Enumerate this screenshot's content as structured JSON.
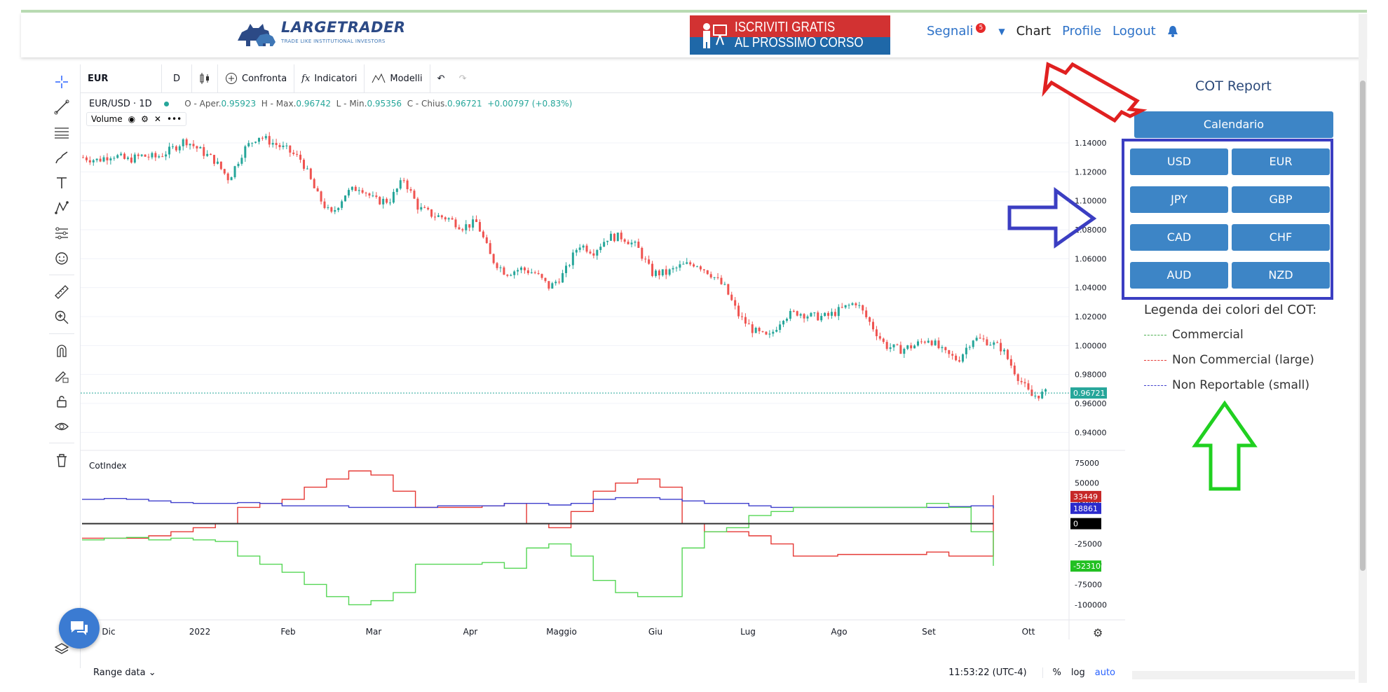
{
  "header": {
    "logo_text": "LARGETRADER",
    "logo_sub": "TRADE LIKE INSTITUTIONAL INVESTORS",
    "banner_line1": "ISCRIVITI GRATIS",
    "banner_line2": "AL PROSSIMO CORSO",
    "nav": {
      "segnali": "Segnali",
      "segnali_badge": "5",
      "chart": "Chart",
      "profile": "Profile",
      "logout": "Logout"
    }
  },
  "toolbar": {
    "symbol": "EUR",
    "interval": "D",
    "compare": "Confronta",
    "indicators": "Indicatori",
    "templates": "Modelli"
  },
  "legend": {
    "pair": "EUR/USD · 1D",
    "open_label": "O - Aper.",
    "open": "0.95923",
    "high_label": "H - Max.",
    "high": "0.96742",
    "low_label": "L - Min.",
    "low": "0.95356",
    "close_label": "C - Chius.",
    "close": "0.96721",
    "change": "+0.00797 (+0.83%)",
    "volume": "Volume",
    "cot_indicator": "CotIndex"
  },
  "chart_data": [
    {
      "type": "candlestick",
      "title": "EUR/USD · 1D",
      "ylim": [
        0.93,
        1.155
      ],
      "yticks": [
        "1.14000",
        "1.12000",
        "1.10000",
        "1.08000",
        "1.06000",
        "1.04000",
        "1.02000",
        "1.00000",
        "0.98000",
        "0.96000",
        "0.94000"
      ],
      "last_price": "0.96721",
      "x_ticks": [
        "Dic",
        "2022",
        "Feb",
        "Mar",
        "Apr",
        "Maggio",
        "Giu",
        "Lug",
        "Ago",
        "Set",
        "Ott"
      ],
      "close_path": [
        1.13,
        1.128,
        1.132,
        1.128,
        1.131,
        1.13,
        1.135,
        1.142,
        1.135,
        1.128,
        1.115,
        1.135,
        1.145,
        1.14,
        1.135,
        1.128,
        1.105,
        1.09,
        1.105,
        1.11,
        1.1,
        1.1,
        1.115,
        1.095,
        1.09,
        1.088,
        1.082,
        1.085,
        1.06,
        1.05,
        1.053,
        1.05,
        1.04,
        1.05,
        1.07,
        1.065,
        1.075,
        1.075,
        1.068,
        1.05,
        1.05,
        1.055,
        1.057,
        1.05,
        1.04,
        1.02,
        1.01,
        1.005,
        1.02,
        1.023,
        1.02,
        1.02,
        1.025,
        1.03,
        1.015,
        1.0,
        0.997,
        1.0,
        1.005,
        0.995,
        0.99,
        1.005,
        1.003,
        0.998,
        0.98,
        0.965,
        0.967
      ]
    },
    {
      "type": "line",
      "title": "CotIndex",
      "ylim": [
        -110000,
        80000
      ],
      "yticks": [
        "75000",
        "50000",
        "25000",
        "0",
        "-25000",
        "-50000",
        "-75000",
        "-100000"
      ],
      "series": [
        {
          "color": "#e53935",
          "last": "33449",
          "values": [
            -18000,
            -18000,
            -18000,
            -15000,
            -10000,
            -5000,
            0,
            20000,
            25000,
            30000,
            45000,
            55000,
            65000,
            60000,
            40000,
            20000,
            20000,
            20000,
            22000,
            25000,
            0,
            -5000,
            15000,
            40000,
            50000,
            55000,
            45000,
            0,
            -10000,
            -10000,
            -15000,
            -25000,
            -40000,
            -40000,
            -38000,
            -38000,
            -38000,
            -38000,
            -35000,
            -40000,
            -40000,
            35000
          ]
        },
        {
          "color": "#3f3fcc",
          "last": "18861",
          "values": [
            30000,
            31000,
            30000,
            28000,
            26000,
            25000,
            25000,
            26000,
            25000,
            22000,
            22000,
            22000,
            20000,
            20000,
            20000,
            20000,
            22000,
            22000,
            22000,
            25000,
            25000,
            23000,
            25000,
            30000,
            32000,
            32000,
            30000,
            28000,
            25000,
            25000,
            22000,
            20000,
            20000,
            20000,
            20000,
            20000,
            20000,
            20000,
            20000,
            21000,
            22000,
            19000
          ]
        },
        {
          "color": "#55d655",
          "last": "-52310",
          "values": [
            -20000,
            -18000,
            -17000,
            -20000,
            -18000,
            -20000,
            -22000,
            -40000,
            -50000,
            -60000,
            -75000,
            -90000,
            -100000,
            -95000,
            -85000,
            -50000,
            -50000,
            -50000,
            -48000,
            -55000,
            -30000,
            -25000,
            -40000,
            -70000,
            -85000,
            -90000,
            -90000,
            -30000,
            -10000,
            -5000,
            10000,
            15000,
            20000,
            20000,
            20000,
            20000,
            20000,
            20000,
            25000,
            20000,
            -10000,
            -52000
          ]
        },
        {
          "color": "#333333",
          "last": "0",
          "values": [
            0,
            0,
            0,
            0,
            0,
            0,
            0,
            0,
            0,
            0,
            0,
            0,
            0,
            0,
            0,
            0,
            0,
            0,
            0,
            0,
            0,
            0,
            0,
            0,
            0,
            0,
            0,
            0,
            0,
            0,
            0,
            0,
            0,
            0,
            0,
            0,
            0,
            0,
            0,
            0,
            0,
            0
          ]
        }
      ]
    }
  ],
  "bottom": {
    "range": "Range data",
    "time": "11:53:22 (UTC-4)",
    "pct": "%",
    "log": "log",
    "auto": "auto"
  },
  "panel": {
    "title": "COT Report",
    "calendar": "Calendario",
    "currencies": [
      "USD",
      "EUR",
      "JPY",
      "GBP",
      "CAD",
      "CHF",
      "AUD",
      "NZD"
    ],
    "legend_title": "Legenda dei colori del COT:",
    "legend_items": [
      {
        "label": "Commercial",
        "color": "#4caf50"
      },
      {
        "label": "Non Commercial (large)",
        "color": "#e53935"
      },
      {
        "label": "Non Reportable (small)",
        "color": "#3f3fcc"
      }
    ]
  },
  "colors": {
    "accent": "#3d85c6",
    "up": "#26a69a",
    "down": "#ef5350",
    "annotation_red": "#e02020",
    "annotation_blue": "#3b3ec2",
    "annotation_green": "#20d020"
  }
}
